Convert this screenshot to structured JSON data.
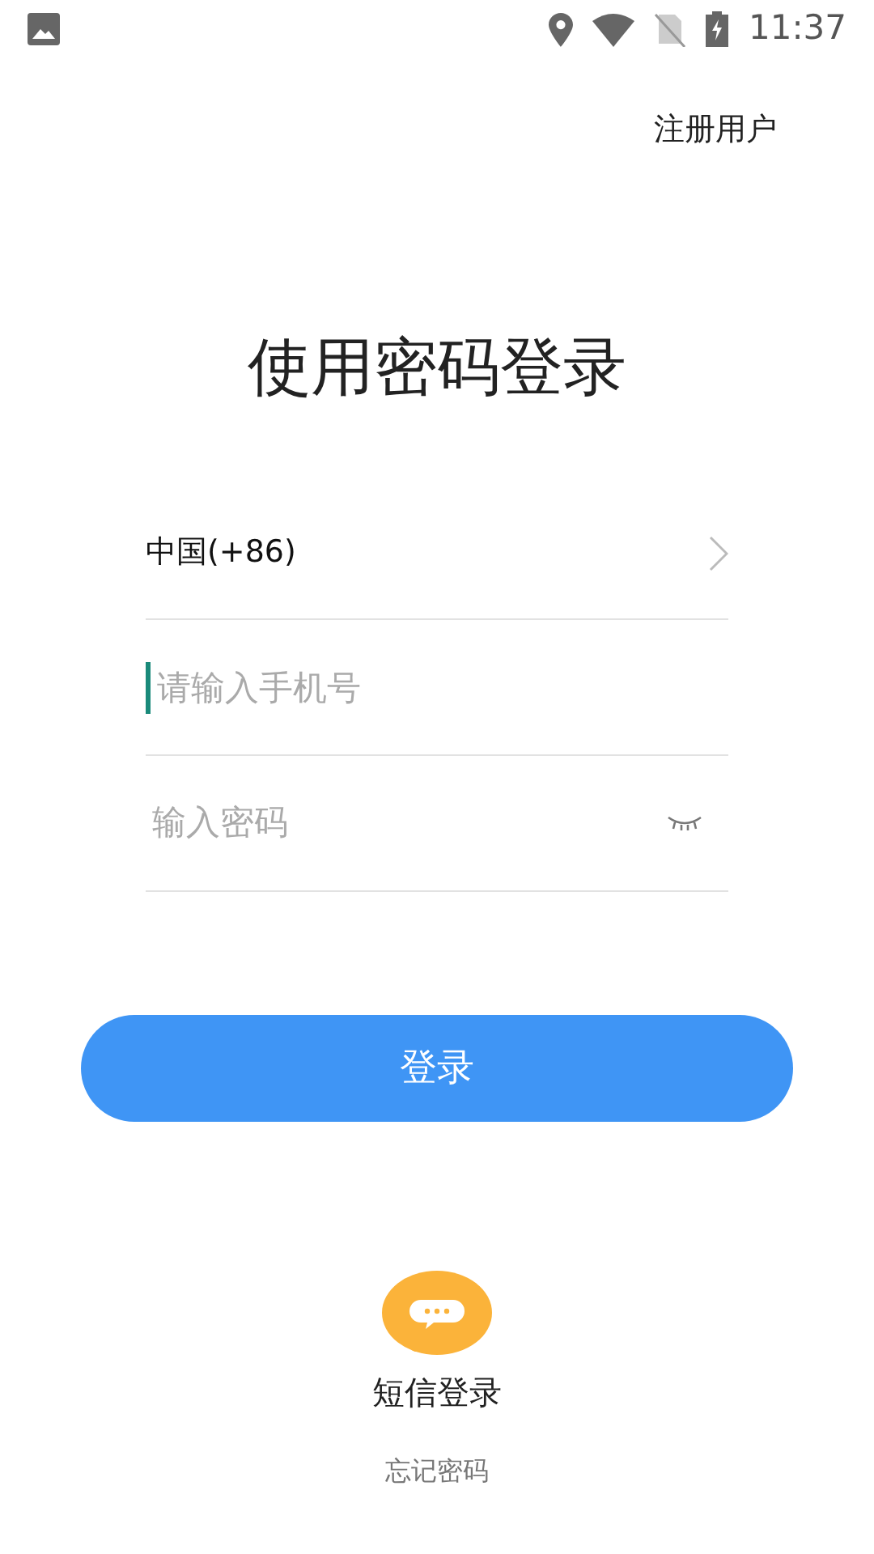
{
  "status_bar": {
    "time": "11:37"
  },
  "register_link": "注册用户",
  "title": "使用密码登录",
  "country": {
    "label": "中国(+86)"
  },
  "phone_field": {
    "placeholder": "请输入手机号",
    "focused": true
  },
  "password_field": {
    "placeholder": "输入密码",
    "password_visible": false
  },
  "login_button": "登录",
  "sms_login": {
    "label": "短信登录"
  },
  "forgot_password": "忘记密码"
}
